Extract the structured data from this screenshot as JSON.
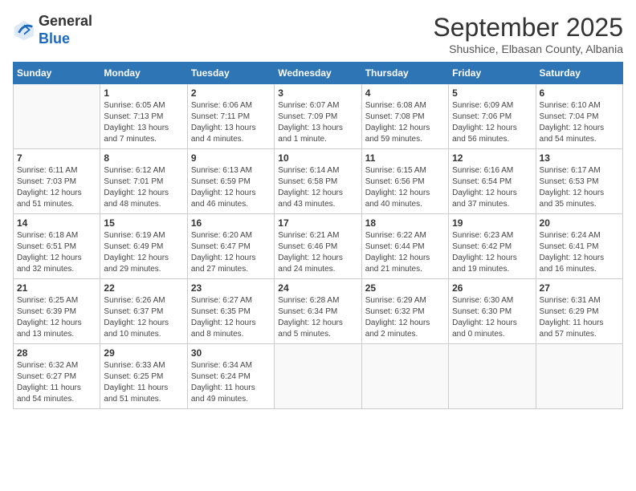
{
  "header": {
    "logo_general": "General",
    "logo_blue": "Blue",
    "month": "September 2025",
    "location": "Shushice, Elbasan County, Albania"
  },
  "days_of_week": [
    "Sunday",
    "Monday",
    "Tuesday",
    "Wednesday",
    "Thursday",
    "Friday",
    "Saturday"
  ],
  "weeks": [
    [
      {
        "day": "",
        "info": ""
      },
      {
        "day": "1",
        "info": "Sunrise: 6:05 AM\nSunset: 7:13 PM\nDaylight: 13 hours\nand 7 minutes."
      },
      {
        "day": "2",
        "info": "Sunrise: 6:06 AM\nSunset: 7:11 PM\nDaylight: 13 hours\nand 4 minutes."
      },
      {
        "day": "3",
        "info": "Sunrise: 6:07 AM\nSunset: 7:09 PM\nDaylight: 13 hours\nand 1 minute."
      },
      {
        "day": "4",
        "info": "Sunrise: 6:08 AM\nSunset: 7:08 PM\nDaylight: 12 hours\nand 59 minutes."
      },
      {
        "day": "5",
        "info": "Sunrise: 6:09 AM\nSunset: 7:06 PM\nDaylight: 12 hours\nand 56 minutes."
      },
      {
        "day": "6",
        "info": "Sunrise: 6:10 AM\nSunset: 7:04 PM\nDaylight: 12 hours\nand 54 minutes."
      }
    ],
    [
      {
        "day": "7",
        "info": "Sunrise: 6:11 AM\nSunset: 7:03 PM\nDaylight: 12 hours\nand 51 minutes."
      },
      {
        "day": "8",
        "info": "Sunrise: 6:12 AM\nSunset: 7:01 PM\nDaylight: 12 hours\nand 48 minutes."
      },
      {
        "day": "9",
        "info": "Sunrise: 6:13 AM\nSunset: 6:59 PM\nDaylight: 12 hours\nand 46 minutes."
      },
      {
        "day": "10",
        "info": "Sunrise: 6:14 AM\nSunset: 6:58 PM\nDaylight: 12 hours\nand 43 minutes."
      },
      {
        "day": "11",
        "info": "Sunrise: 6:15 AM\nSunset: 6:56 PM\nDaylight: 12 hours\nand 40 minutes."
      },
      {
        "day": "12",
        "info": "Sunrise: 6:16 AM\nSunset: 6:54 PM\nDaylight: 12 hours\nand 37 minutes."
      },
      {
        "day": "13",
        "info": "Sunrise: 6:17 AM\nSunset: 6:53 PM\nDaylight: 12 hours\nand 35 minutes."
      }
    ],
    [
      {
        "day": "14",
        "info": "Sunrise: 6:18 AM\nSunset: 6:51 PM\nDaylight: 12 hours\nand 32 minutes."
      },
      {
        "day": "15",
        "info": "Sunrise: 6:19 AM\nSunset: 6:49 PM\nDaylight: 12 hours\nand 29 minutes."
      },
      {
        "day": "16",
        "info": "Sunrise: 6:20 AM\nSunset: 6:47 PM\nDaylight: 12 hours\nand 27 minutes."
      },
      {
        "day": "17",
        "info": "Sunrise: 6:21 AM\nSunset: 6:46 PM\nDaylight: 12 hours\nand 24 minutes."
      },
      {
        "day": "18",
        "info": "Sunrise: 6:22 AM\nSunset: 6:44 PM\nDaylight: 12 hours\nand 21 minutes."
      },
      {
        "day": "19",
        "info": "Sunrise: 6:23 AM\nSunset: 6:42 PM\nDaylight: 12 hours\nand 19 minutes."
      },
      {
        "day": "20",
        "info": "Sunrise: 6:24 AM\nSunset: 6:41 PM\nDaylight: 12 hours\nand 16 minutes."
      }
    ],
    [
      {
        "day": "21",
        "info": "Sunrise: 6:25 AM\nSunset: 6:39 PM\nDaylight: 12 hours\nand 13 minutes."
      },
      {
        "day": "22",
        "info": "Sunrise: 6:26 AM\nSunset: 6:37 PM\nDaylight: 12 hours\nand 10 minutes."
      },
      {
        "day": "23",
        "info": "Sunrise: 6:27 AM\nSunset: 6:35 PM\nDaylight: 12 hours\nand 8 minutes."
      },
      {
        "day": "24",
        "info": "Sunrise: 6:28 AM\nSunset: 6:34 PM\nDaylight: 12 hours\nand 5 minutes."
      },
      {
        "day": "25",
        "info": "Sunrise: 6:29 AM\nSunset: 6:32 PM\nDaylight: 12 hours\nand 2 minutes."
      },
      {
        "day": "26",
        "info": "Sunrise: 6:30 AM\nSunset: 6:30 PM\nDaylight: 12 hours\nand 0 minutes."
      },
      {
        "day": "27",
        "info": "Sunrise: 6:31 AM\nSunset: 6:29 PM\nDaylight: 11 hours\nand 57 minutes."
      }
    ],
    [
      {
        "day": "28",
        "info": "Sunrise: 6:32 AM\nSunset: 6:27 PM\nDaylight: 11 hours\nand 54 minutes."
      },
      {
        "day": "29",
        "info": "Sunrise: 6:33 AM\nSunset: 6:25 PM\nDaylight: 11 hours\nand 51 minutes."
      },
      {
        "day": "30",
        "info": "Sunrise: 6:34 AM\nSunset: 6:24 PM\nDaylight: 11 hours\nand 49 minutes."
      },
      {
        "day": "",
        "info": ""
      },
      {
        "day": "",
        "info": ""
      },
      {
        "day": "",
        "info": ""
      },
      {
        "day": "",
        "info": ""
      }
    ]
  ]
}
